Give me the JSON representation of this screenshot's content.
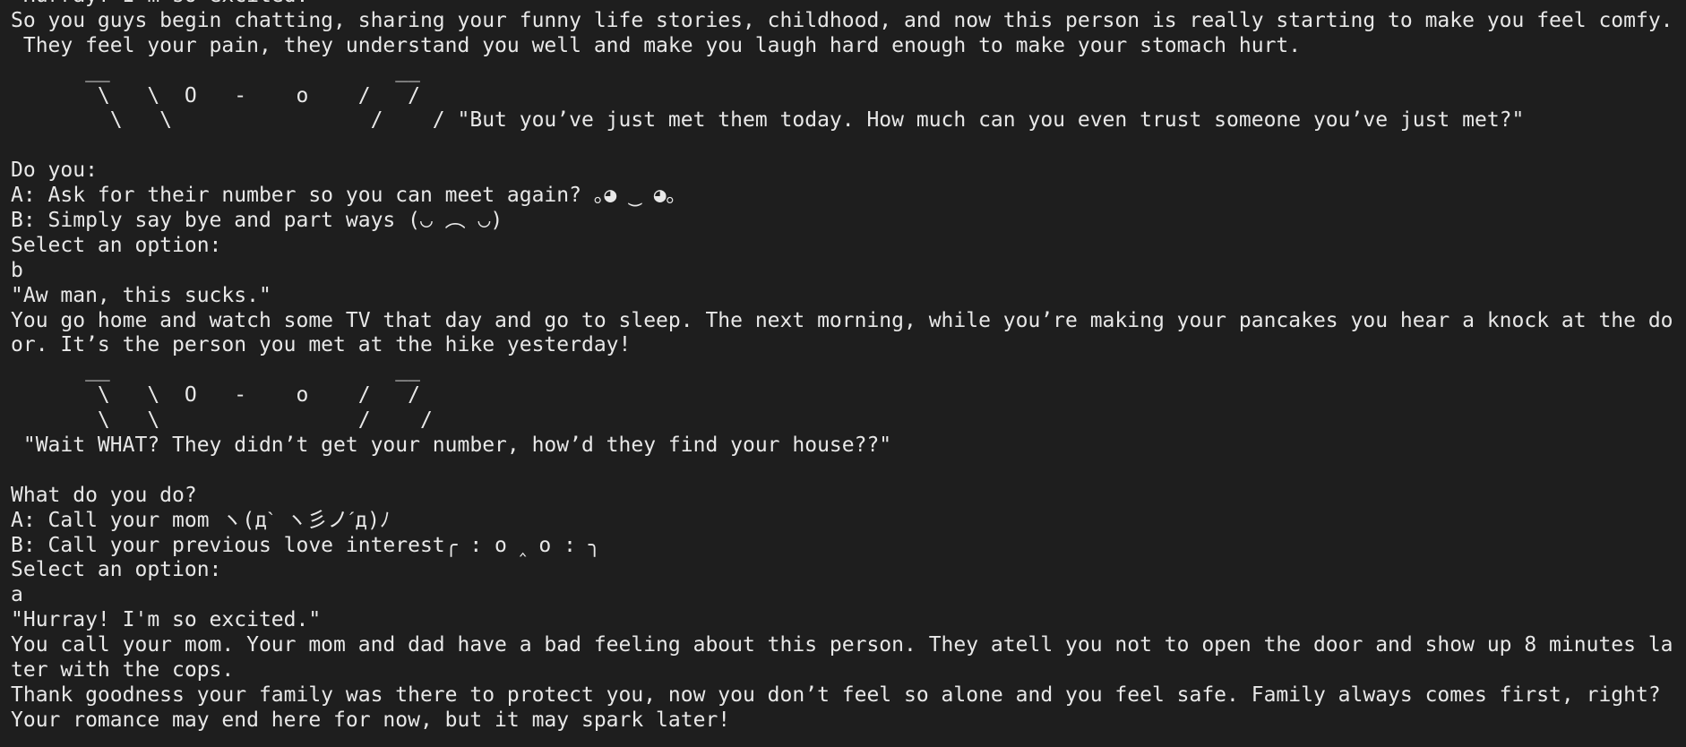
{
  "terminal": {
    "lines": [
      " Hurray! I'm so excited.",
      "So you guys begin chatting, sharing your funny life stories, childhood, and now this person is really starting to make you feel comfy.",
      " They feel your pain, they understand you well and make you laugh hard enough to make your stomach hurt.",
      "      __                       __",
      "       \\   \\  O   -    o    /   /",
      "        \\   \\                /    / \"But you’ve just met them today. How much can you even trust someone you’ve just met?\"",
      "",
      "Do you:",
      "A: Ask for their number so you can meet again? ｡◕ ‿ ◕｡",
      "B: Simply say bye and part ways (◡ ︵ ◡)",
      "Select an option:",
      "b",
      "\"Aw man, this sucks.\"",
      "You go home and watch some TV that day and go to sleep. The next morning, while you’re making your pancakes you hear a knock at the do",
      "or. It’s the person you met at the hike yesterday!",
      "      __                       __",
      "       \\   \\  O   -    o    /   /",
      "       \\   \\                /    /",
      " \"Wait WHAT? They didn’t get your number, how’d they find your house??\"",
      "",
      "What do you do?",
      "A: Call your mom ヽ(дˋ ヽ彡ノˊд)ﾉ",
      "B: Call your previous love interest╭ : o ‸ o : ╮",
      "Select an option:",
      "a",
      "\"Hurray! I'm so excited.\"",
      "You call your mom. Your mom and dad have a bad feeling about this person. They atell you not to open the door and show up 8 minutes la",
      "ter with the cops.",
      "Thank goodness your family was there to protect you, now you don’t feel so alone and you feel safe. Family always comes first, right?",
      "Your romance may end here for now, but it may spark later!"
    ]
  }
}
